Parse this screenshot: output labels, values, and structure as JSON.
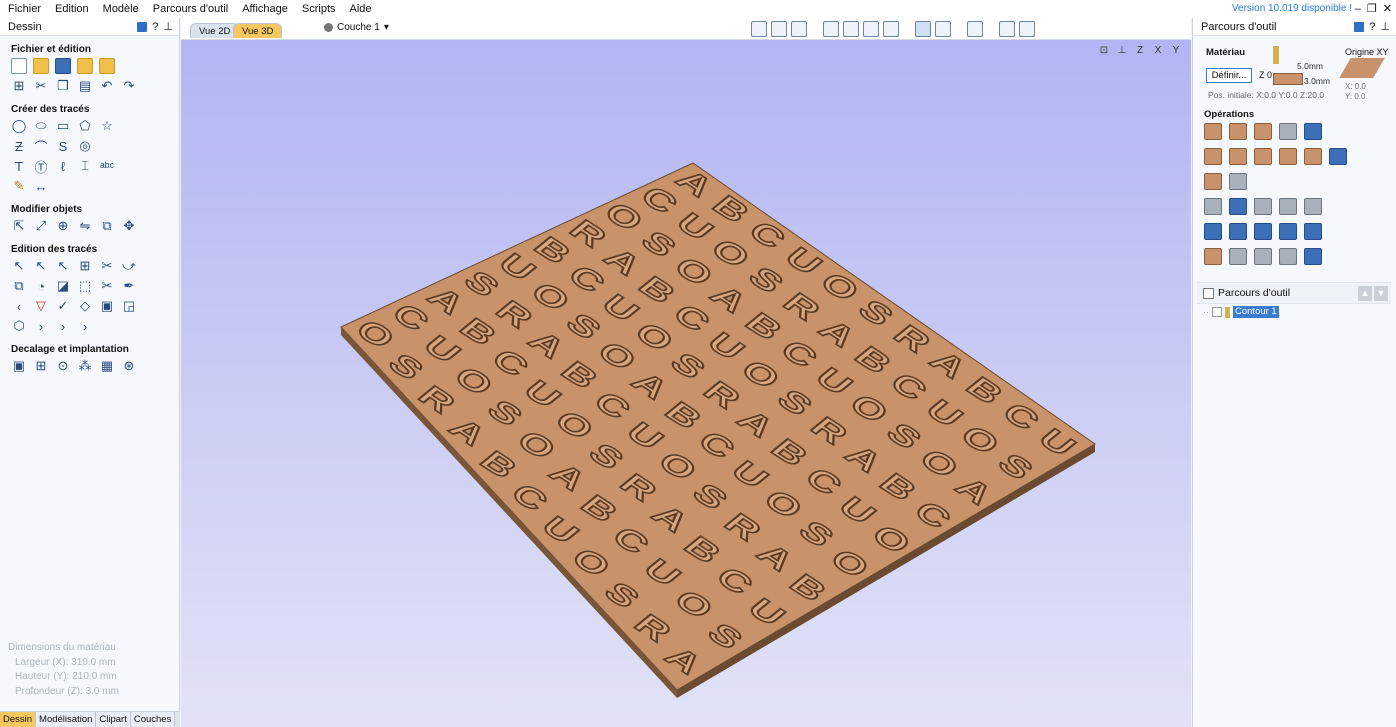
{
  "menu": [
    "Fichier",
    "Edition",
    "Modèle",
    "Parcours d'outil",
    "Affichage",
    "Scripts",
    "Aide"
  ],
  "version": "Version 10.019 disponible !",
  "window_controls": [
    "–",
    "❐",
    "✕"
  ],
  "left_panel": {
    "title": "Dessin",
    "sections": [
      {
        "title": "Fichier et édition",
        "rows": [
          [
            "new-file-icon",
            "open-file-icon",
            "save-file-icon",
            "open-folder-icon",
            "import-icon"
          ],
          [
            "select-all-icon",
            "cut-icon",
            "copy-icon",
            "paste-icon",
            "undo-icon",
            "redo-icon"
          ]
        ]
      },
      {
        "title": "Créer des tracés",
        "rows": [
          [
            "circle-icon",
            "ellipse-icon",
            "rectangle-icon",
            "polygon-icon",
            "star-icon"
          ],
          [
            "polyline-icon",
            "arc-icon",
            "curve-icon",
            "spiral-icon"
          ],
          [
            "text-icon",
            "text-box-icon",
            "text-on-curve-icon",
            "text-arc-icon",
            "text-block-icon"
          ],
          [
            "pen-icon",
            "dimension-icon"
          ]
        ]
      },
      {
        "title": "Modifier objets",
        "rows": [
          [
            "move-icon",
            "scale-icon",
            "rotate-icon",
            "mirror-icon",
            "distort-icon",
            "nudge-icon"
          ]
        ]
      },
      {
        "title": "Edition des tracés",
        "rows": [
          [
            "select-icon",
            "node-edit-icon",
            "subdivide-icon",
            "align-icon",
            "trim-icon",
            "extend-icon"
          ],
          [
            "weld-icon",
            "subtract-icon",
            "intersect-icon",
            "join-icon",
            "scissors-icon",
            "fillet-icon"
          ],
          [
            "chamfer-icon",
            "close-vector-icon",
            "smooth-icon",
            "offset-icon",
            "image-icon",
            "layer-tool-icon"
          ],
          [
            "group-icon",
            "ungroup-icon",
            "lock-icon",
            "unlock-icon"
          ]
        ]
      },
      {
        "title": "Decalage et implantation",
        "rows": [
          [
            "offset-vector-icon",
            "nesting-icon",
            "array-icon",
            "step-repeat-icon",
            "grid-layout-icon",
            "circular-array-icon"
          ]
        ]
      }
    ],
    "dimensions": {
      "title": "Dimensions du matériau",
      "width": "Largeur   (X): 310.0 mm",
      "height": "Hauteur   (Y): 210.0 mm",
      "depth": "Profondeur (Z): 3.0 mm"
    },
    "tabs": [
      "Dessin",
      "Modélisation",
      "Clipart",
      "Couches"
    ],
    "active_tab": "Dessin"
  },
  "center": {
    "view_tabs": [
      "Vue 2D",
      "Vue 3D"
    ],
    "active_view": "Vue 3D",
    "layer": "Couche 1"
  },
  "right_panel": {
    "title": "Parcours d'outil",
    "material_title": "Matériau",
    "define_button": "Définir...",
    "z_label": "Z 0",
    "dim_top": "5.0mm",
    "dim_bottom": "3.0mm",
    "origin_title": "Origine XY",
    "origin_x": "X: 0.0",
    "origin_y": "Y: 0.0",
    "pos_initiale": "Pos. initiale: X:0.0 Y:0.0 Z:20.0",
    "operations_title": "Opérations",
    "toolpaths_header": "Parcours d'outil",
    "toolpath_items": [
      "Contour 1"
    ]
  },
  "colors": {
    "viewport_top": "#b2b5f2",
    "viewport_bottom": "#e2e3f6",
    "wood": "#c8936a",
    "wood_dark": "#8c5f3d",
    "accent_blue": "#3b7bd2",
    "active_tab": "#f7c860"
  }
}
